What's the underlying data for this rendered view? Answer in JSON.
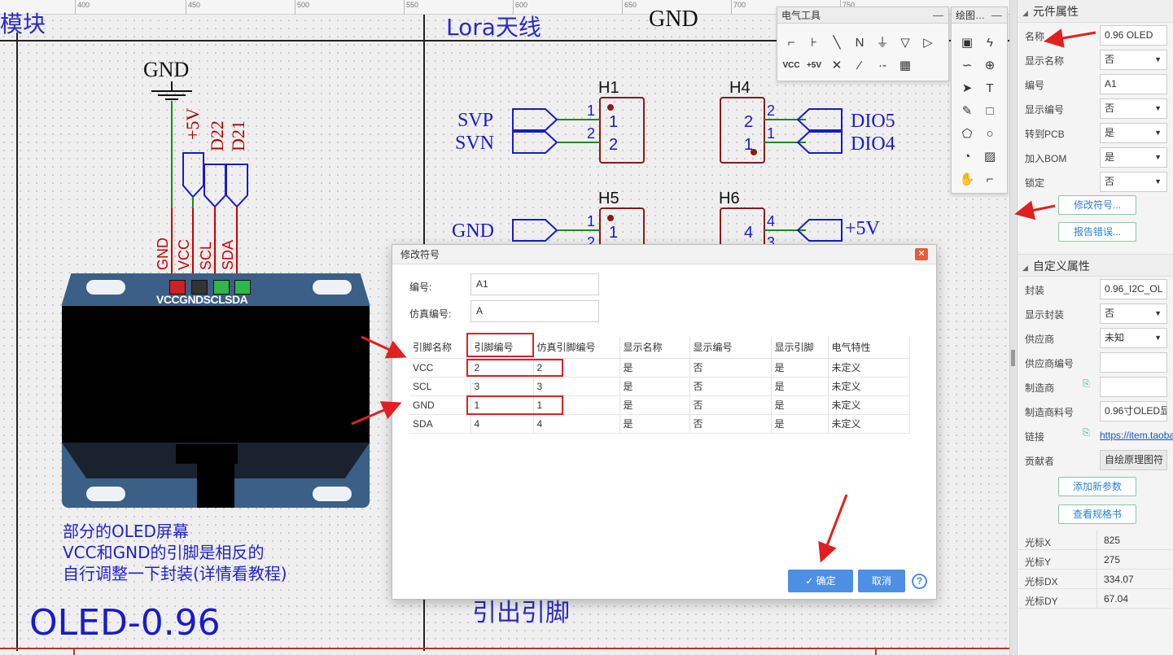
{
  "ruler": {
    "ticks": [
      "400",
      "450",
      "500",
      "550",
      "600",
      "650",
      "700",
      "750"
    ]
  },
  "canvas": {
    "partial_top_text": "模块",
    "lora_label": "Lora天线",
    "gnd_top": "GND",
    "oled_note_lines": [
      "部分的OLED屏幕",
      "VCC和GND的引脚是相反的",
      "自行调整一下封装(详情看教程)"
    ],
    "oled_title": "OLED-0.96",
    "pinout_label": "引出引脚",
    "oled_pin_label": "VCCGNDSCLSDA",
    "schematic": {
      "gnd_symbol": "GND",
      "net_labels": [
        "+5V",
        "D22",
        "D21"
      ],
      "oled_pins": [
        "GND",
        "VCC",
        "SCL",
        "SDA"
      ],
      "headers": [
        {
          "ref": "H1",
          "left_nets": [
            "SVP",
            "SVN"
          ],
          "pin_labels": [
            "1",
            "2"
          ],
          "pins": [
            "1",
            "2"
          ]
        },
        {
          "ref": "H4",
          "right_nets": [
            "DIO5",
            "DIO4"
          ],
          "pin_labels": [
            "2",
            "1"
          ],
          "pins": [
            "2",
            "1"
          ]
        },
        {
          "ref": "H5",
          "left_nets": [
            "GND"
          ],
          "pin_labels": [
            "1",
            "2"
          ],
          "pins": [
            "1"
          ]
        },
        {
          "ref": "H6",
          "right_nets": [
            "+5V"
          ],
          "pin_labels": [
            "4",
            "3"
          ],
          "pins": [
            "4"
          ]
        }
      ]
    }
  },
  "electrical_tools": {
    "title": "电气工具",
    "minimize": "—",
    "tools": [
      "wire-icon",
      "bus-icon",
      "bus-entry-icon",
      "net-label-icon",
      "ground-icon",
      "net-flag-icon",
      "netport-icon",
      "vcc-icon",
      "plus5v-icon",
      "no-connect-icon",
      "voltage-probe-icon",
      "pin-icon",
      "group-icon"
    ],
    "tool_glyphs": [
      "⌐",
      "⊦",
      "╲",
      "N",
      "⏚",
      "▽",
      "▷",
      "VCC",
      "+5V",
      "✕",
      "⁄",
      "·-",
      "▦"
    ]
  },
  "drawing_tools": {
    "title": "绘图…",
    "minimize": "—",
    "tools": [
      "image-rect-icon",
      "polyline-icon",
      "arc-icon",
      "pie-icon",
      "arrowhead-icon",
      "text-icon",
      "freehand-icon",
      "rectangle-icon",
      "polygon-icon",
      "circle-icon",
      "pie-arc-icon",
      "picture-icon",
      "pan-hand-icon",
      "dimension-icon"
    ],
    "tool_glyphs": [
      "▣",
      "ϟ",
      "∽",
      "⊕",
      "➤",
      "T",
      "✎",
      "□",
      "⬠",
      "○",
      "◔",
      "▨",
      "✋",
      "⌐"
    ]
  },
  "component_props": {
    "title": "元件属性",
    "rows": [
      {
        "label": "名称",
        "value": "0.96 OLED",
        "type": "text"
      },
      {
        "label": "显示名称",
        "value": "否",
        "type": "select"
      },
      {
        "label": "编号",
        "value": "A1",
        "type": "text"
      },
      {
        "label": "显示编号",
        "value": "否",
        "type": "select"
      },
      {
        "label": "转到PCB",
        "value": "是",
        "type": "select"
      },
      {
        "label": "加入BOM",
        "value": "是",
        "type": "select"
      },
      {
        "label": "锁定",
        "value": "否",
        "type": "select"
      }
    ],
    "btn_modify_symbol": "修改符号...",
    "btn_report_error": "报告错误..."
  },
  "custom_props": {
    "title": "自定义属性",
    "rows": [
      {
        "label": "封装",
        "value": "0.96_I2C_OL",
        "type": "text"
      },
      {
        "label": "显示封装",
        "value": "否",
        "type": "select"
      },
      {
        "label": "供应商",
        "value": "未知",
        "type": "select"
      },
      {
        "label": "供应商编号",
        "value": "",
        "type": "text"
      },
      {
        "label": "制造商",
        "value": "",
        "type": "text",
        "icon": "edit-icon"
      },
      {
        "label": "制造商料号",
        "value": "0.96寸OLED显",
        "type": "text"
      },
      {
        "label": "链接",
        "value": "https://item.taoba",
        "type": "link",
        "icon": "edit-icon"
      },
      {
        "label": "贡献者",
        "value": "自绘原理图符",
        "type": "gray"
      }
    ],
    "btn_add_param": "添加新参数",
    "btn_datasheet": "查看规格书"
  },
  "cursor": {
    "rows": [
      {
        "label": "光标X",
        "value": "825"
      },
      {
        "label": "光标Y",
        "value": "275"
      },
      {
        "label": "光标DX",
        "value": "334.07"
      },
      {
        "label": "光标DY",
        "value": "67.04"
      }
    ]
  },
  "dialog": {
    "title": "修改符号",
    "close": "✕",
    "ref_label": "编号:",
    "ref_value": "A1",
    "sim_label": "仿真编号:",
    "sim_value": "A",
    "columns": [
      "引脚名称",
      "引脚编号",
      "仿真引脚编号",
      "显示名称",
      "显示编号",
      "显示引脚",
      "电气特性"
    ],
    "rows": [
      [
        "VCC",
        "2",
        "2",
        "是",
        "否",
        "是",
        "未定义"
      ],
      [
        "SCL",
        "3",
        "3",
        "是",
        "否",
        "是",
        "未定义"
      ],
      [
        "GND",
        "1",
        "1",
        "是",
        "否",
        "是",
        "未定义"
      ],
      [
        "SDA",
        "4",
        "4",
        "是",
        "否",
        "是",
        "未定义"
      ]
    ],
    "ok": "✓ 确定",
    "cancel": "取消",
    "help": "?"
  },
  "colors": {
    "accent": "#4e8fe6",
    "annotation_red": "#e02020",
    "net_blue": "#1a1acc",
    "wire_green": "#1e8a1e",
    "pin_red": "#b30000"
  }
}
